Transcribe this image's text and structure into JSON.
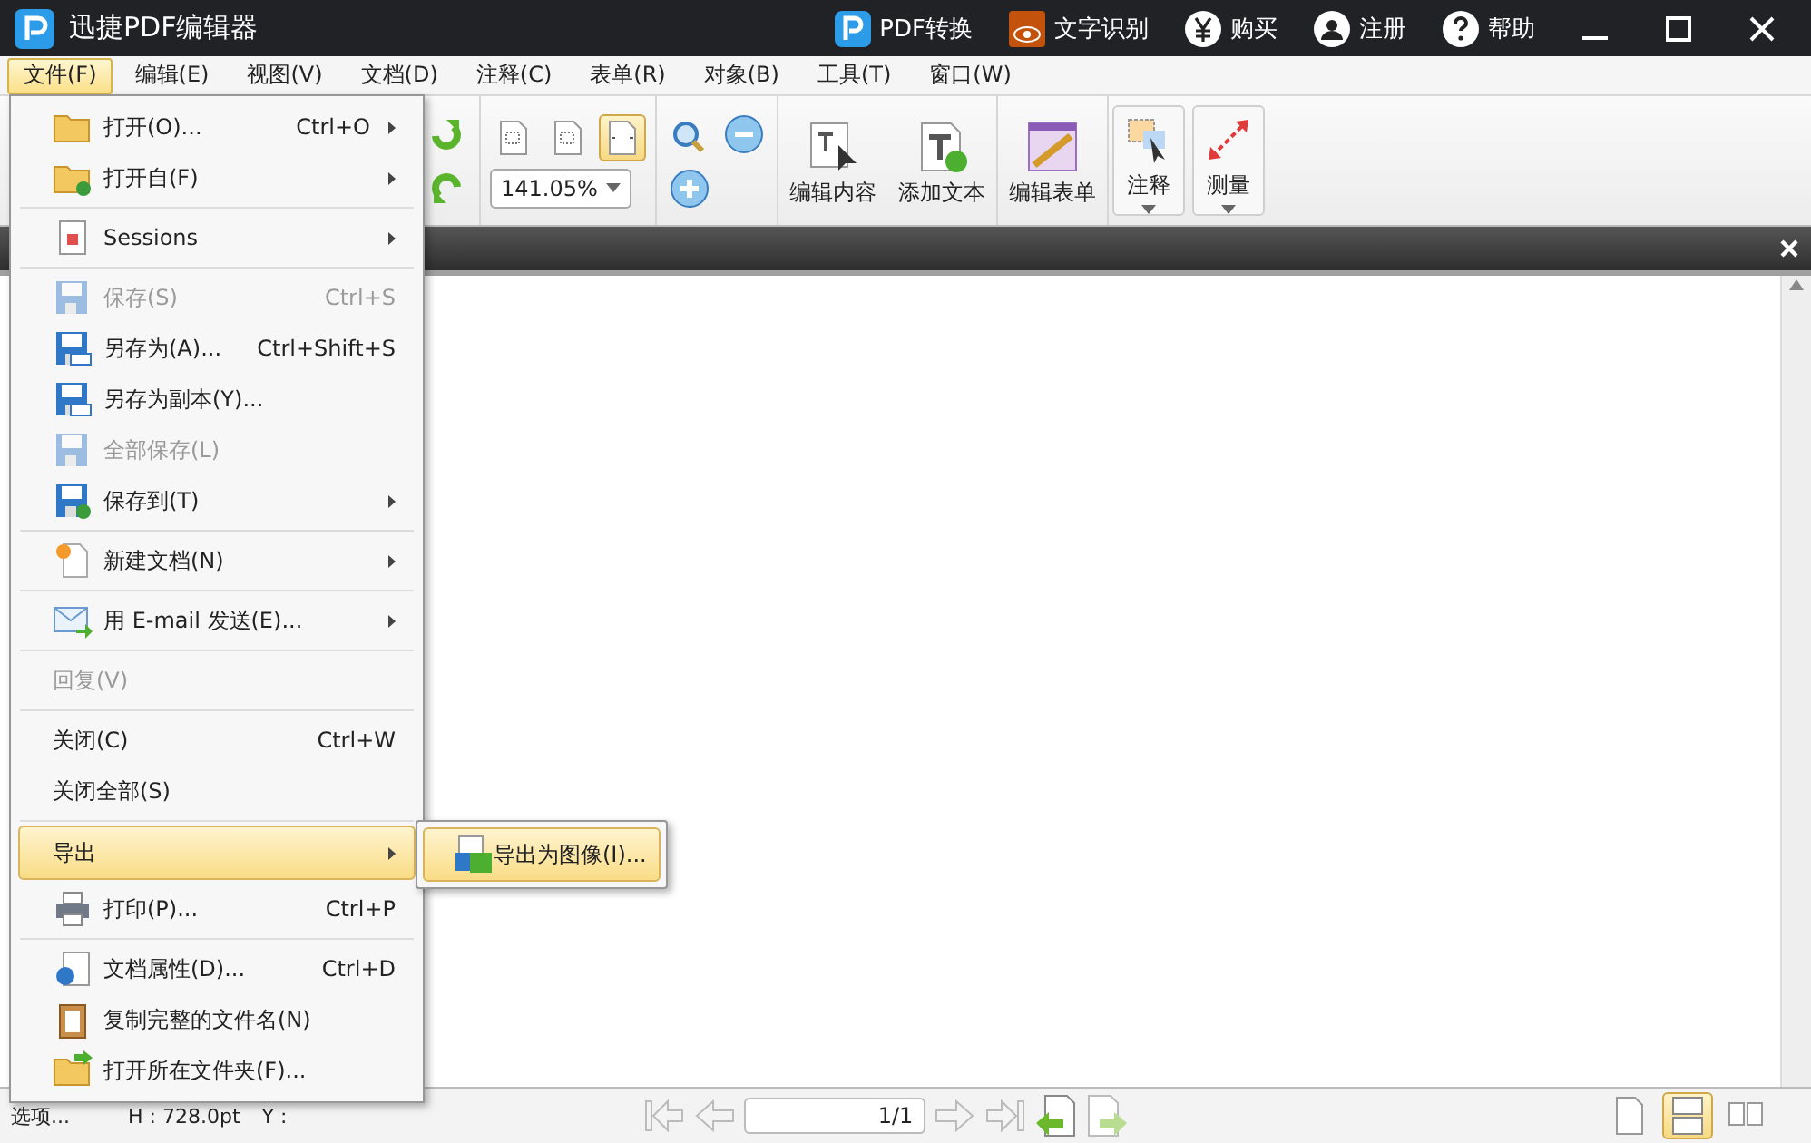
{
  "window": {
    "title": "迅捷PDF编辑器"
  },
  "title_actions": [
    {
      "label": "PDF转换"
    },
    {
      "label": "文字识别"
    },
    {
      "label": "购买"
    },
    {
      "label": "注册"
    },
    {
      "label": "帮助"
    }
  ],
  "menu_bar": [
    {
      "label": "文件(F)",
      "selected": true
    },
    {
      "label": "编辑(E)",
      "selected": false
    },
    {
      "label": "视图(V)",
      "selected": false
    },
    {
      "label": "文档(D)",
      "selected": false
    },
    {
      "label": "注释(C)",
      "selected": false
    },
    {
      "label": "表单(R)",
      "selected": false
    },
    {
      "label": "对象(B)",
      "selected": false
    },
    {
      "label": "工具(T)",
      "selected": false
    },
    {
      "label": "窗口(W)",
      "selected": false
    }
  ],
  "toolbar": {
    "zoom_modes": [
      {
        "selected": false
      },
      {
        "selected": false
      },
      {
        "selected": true
      }
    ],
    "zoom": "141.05%",
    "buttons": [
      {
        "label": "编辑内容",
        "dropdown": false
      },
      {
        "label": "添加文本",
        "dropdown": false
      },
      {
        "label": "编辑表单",
        "dropdown": false
      },
      {
        "label": "注释",
        "dropdown": true
      },
      {
        "label": "测量",
        "dropdown": true
      }
    ]
  },
  "file_menu": [
    {
      "kind": "item",
      "label": "打开(O)...",
      "shortcut": "Ctrl+O",
      "submenu": true,
      "disabled": false,
      "selected": false
    },
    {
      "kind": "item",
      "label": "打开自(F)",
      "submenu": true,
      "disabled": false,
      "selected": false
    },
    {
      "kind": "separator"
    },
    {
      "kind": "item",
      "label": "Sessions",
      "submenu": true,
      "disabled": false,
      "selected": false
    },
    {
      "kind": "separator"
    },
    {
      "kind": "item",
      "label": "保存(S)",
      "shortcut": "Ctrl+S",
      "submenu": false,
      "disabled": true,
      "selected": false
    },
    {
      "kind": "item",
      "label": "另存为(A)...",
      "shortcut": "Ctrl+Shift+S",
      "submenu": false,
      "disabled": false,
      "selected": false
    },
    {
      "kind": "item",
      "label": "另存为副本(Y)...",
      "submenu": false,
      "disabled": false,
      "selected": false
    },
    {
      "kind": "item",
      "label": "全部保存(L)",
      "submenu": false,
      "disabled": true,
      "selected": false
    },
    {
      "kind": "item",
      "label": "保存到(T)",
      "submenu": true,
      "disabled": false,
      "selected": false
    },
    {
      "kind": "separator"
    },
    {
      "kind": "item",
      "label": "新建文档(N)",
      "submenu": true,
      "disabled": false,
      "selected": false
    },
    {
      "kind": "separator"
    },
    {
      "kind": "item",
      "label": "用 E-mail 发送(E)...",
      "submenu": true,
      "disabled": false,
      "selected": false
    },
    {
      "kind": "separator"
    },
    {
      "kind": "item",
      "label": "回复(V)",
      "submenu": false,
      "disabled": true,
      "selected": false
    },
    {
      "kind": "separator"
    },
    {
      "kind": "item",
      "label": "关闭(C)",
      "shortcut": "Ctrl+W",
      "submenu": false,
      "disabled": false,
      "selected": false
    },
    {
      "kind": "item",
      "label": "关闭全部(S)",
      "submenu": false,
      "disabled": false,
      "selected": false
    },
    {
      "kind": "separator"
    },
    {
      "kind": "item",
      "label": "导出",
      "submenu": true,
      "disabled": false,
      "selected": true
    },
    {
      "kind": "item",
      "label": "打印(P)...",
      "shortcut": "Ctrl+P",
      "submenu": false,
      "disabled": false,
      "selected": false
    },
    {
      "kind": "separator"
    },
    {
      "kind": "item",
      "label": "文档属性(D)...",
      "shortcut": "Ctrl+D",
      "submenu": false,
      "disabled": false,
      "selected": false
    },
    {
      "kind": "item",
      "label": "复制完整的文件名(N)",
      "submenu": false,
      "disabled": false,
      "selected": false
    },
    {
      "kind": "item",
      "label": "打开所在文件夹(F)...",
      "submenu": false,
      "disabled": false,
      "selected": false
    }
  ],
  "export_submenu": [
    {
      "label": "导出为图像(I)...",
      "selected": true
    }
  ],
  "status_bar": {
    "options": "选项...",
    "height": "H : 728.0pt",
    "y": "Y :",
    "page": "1/1",
    "layouts": [
      {
        "selected": false
      },
      {
        "selected": true
      },
      {
        "selected": false
      }
    ]
  }
}
